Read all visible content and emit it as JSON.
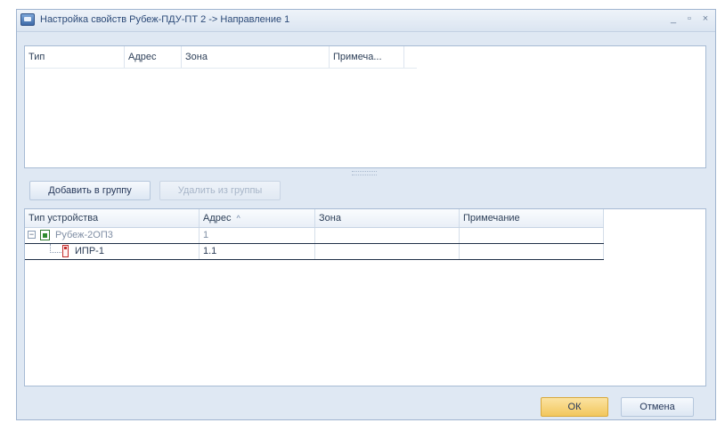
{
  "window": {
    "title": "Настройка свойств Рубеж-ПДУ-ПТ 2 -> Направление 1",
    "minimize_glyph": "_",
    "maximize_glyph": "▫",
    "close_glyph": "×"
  },
  "top_grid": {
    "columns": [
      "Тип",
      "Адрес",
      "Зона",
      "Примеча..."
    ]
  },
  "actions": {
    "add_to_group": "Добавить в группу",
    "remove_from_group": "Удалить из группы"
  },
  "bottom_grid": {
    "columns": [
      "Тип устройства",
      "Адрес",
      "Зона",
      "Примечание"
    ],
    "sort_indicator": "^",
    "rows": [
      {
        "name": "Рубеж-2ОП3",
        "address": "1",
        "zone": "",
        "note": ""
      },
      {
        "name": "ИПР-1",
        "address": "1.1",
        "zone": "",
        "note": ""
      }
    ]
  },
  "dialog": {
    "ok": "ОК",
    "cancel": "Отмена"
  },
  "colors": {
    "ok_button": "#f5cf6e",
    "window_bg": "#dfe8f3"
  }
}
